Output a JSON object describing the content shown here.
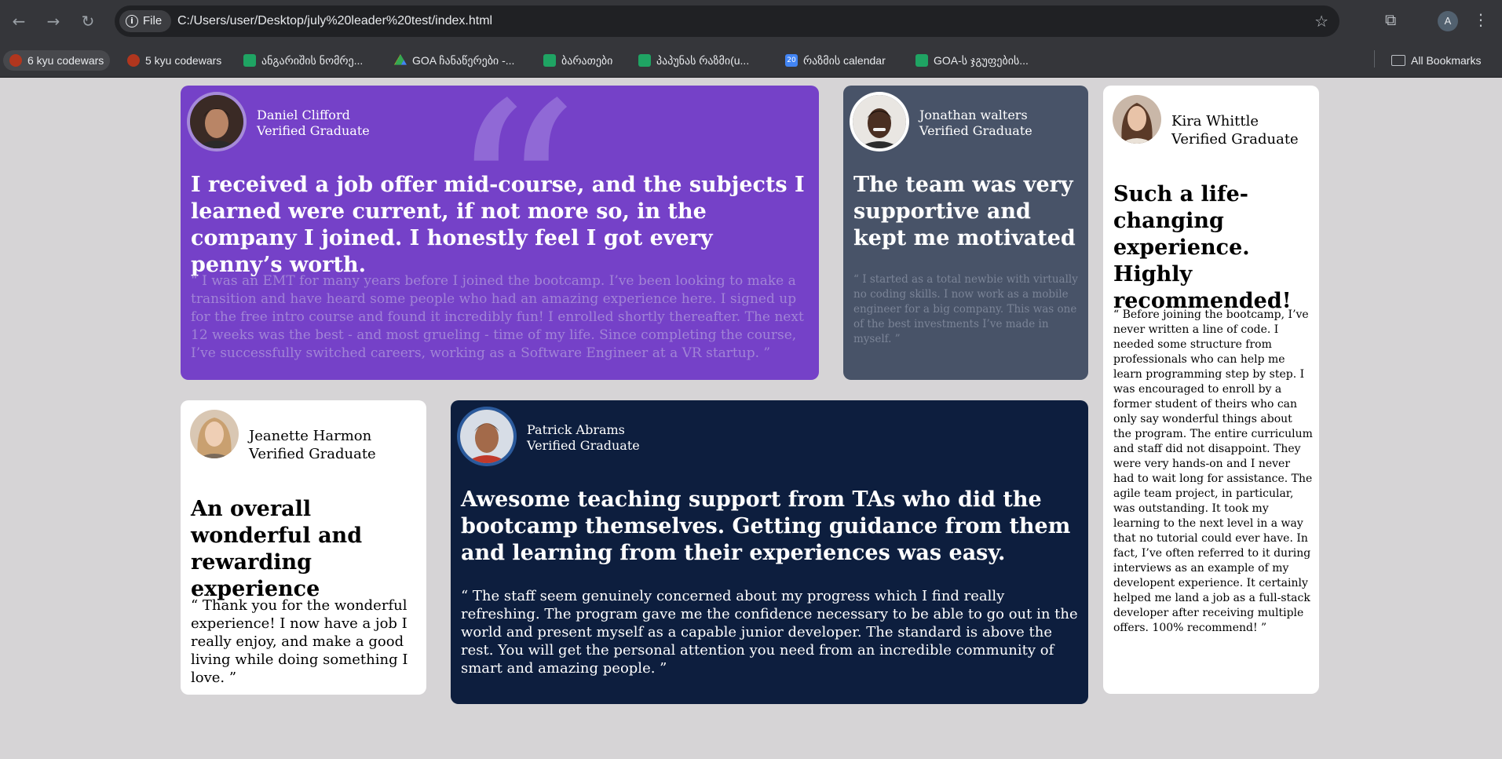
{
  "browser": {
    "file_label": "File",
    "url": "C:/Users/user/Desktop/july%20leader%20test/index.html",
    "profile_initial": "A",
    "bookmarks": [
      {
        "label": "6 kyu codewars",
        "icon": "codewars-icon"
      },
      {
        "label": "5 kyu codewars",
        "icon": "codewars-icon"
      },
      {
        "label": "ანგარიშის ნომრე...",
        "icon": "sheets-icon"
      },
      {
        "label": "GOA ჩანაწერები -...",
        "icon": "drive-icon"
      },
      {
        "label": "ბარათები",
        "icon": "sheets-icon"
      },
      {
        "label": "პაპუნას რაზმი(u...",
        "icon": "sheets-icon"
      },
      {
        "label": "რაზმის calendar",
        "icon": "calendar-icon"
      },
      {
        "label": "GOA-ს ჯგუფების...",
        "icon": "sheets-icon"
      }
    ],
    "all_bookmarks": "All Bookmarks",
    "calendar_number": "20"
  },
  "testimonials": {
    "daniel": {
      "name": "Daniel Clifford",
      "role": "Verified Graduate",
      "headline": "I received a job offer mid-course, and the subjects I learned were current, if not more so, in the company I joined. I honestly feel I got every penny’s worth.",
      "quote": "“ I was an EMT for many years before I joined the bootcamp. I’ve been looking to make a transition and have heard some people who had an amazing experience here. I signed up for the free intro course and found it incredibly fun! I enrolled shortly thereafter. The next 12 weeks was the best - and most grueling - time of my life. Since completing the course, I’ve successfully switched careers, working as a Software Engineer at a VR startup. ”"
    },
    "jonathan": {
      "name": "Jonathan walters",
      "role": "Verified Graduate",
      "headline": "The team was very supportive and kept me motivated",
      "quote": "“ I started as a total newbie with virtually no coding skills. I now work as a mobile engineer for a big company. This was one of the best investments I’ve made in myself. ”"
    },
    "kira": {
      "name": "Kira Whittle",
      "role": "Verified Graduate",
      "headline": "Such a life-changing experience. Highly recommended!",
      "quote": "“ Before joining the bootcamp, I’ve never written a line of code. I needed some structure from professionals who can help me learn programming step by step. I was encouraged to enroll by a former student of theirs who can only say wonderful things about the program. The entire curriculum and staff did not disappoint. They were very hands-on and I never had to wait long for assistance. The agile team project, in particular, was outstanding. It took my learning to the next level in a way that no tutorial could ever have. In fact, I’ve often referred to it during interviews as an example of my developent experience. It certainly helped me land a job as a full-stack developer after receiving multiple offers. 100% recommend! ”"
    },
    "jeanette": {
      "name": "Jeanette Harmon",
      "role": "Verified Graduate",
      "headline": "An overall wonderful and rewarding experience",
      "quote": "“ Thank you for the wonderful experience! I now have a job I really enjoy, and make a good living while doing something I love. ”"
    },
    "patrick": {
      "name": "Patrick Abrams",
      "role": "Verified Graduate",
      "headline": "Awesome teaching support from TAs who did the bootcamp themselves. Getting guidance from them and learning from their experiences was easy.",
      "quote": "“ The staff seem genuinely concerned about my progress which I find really refreshing. The program gave me the confidence necessary to be able to go out in the world and present myself as a capable junior developer. The standard is above the rest. You will get the personal attention you need from an incredible community of smart and amazing people. ”"
    }
  },
  "colors": {
    "page_bg": "#d6d4d6",
    "daniel_bg": "#7541c8",
    "jonathan_bg": "#485368",
    "patrick_bg": "#0d1e3e",
    "light_card_bg": "#ffffff"
  }
}
